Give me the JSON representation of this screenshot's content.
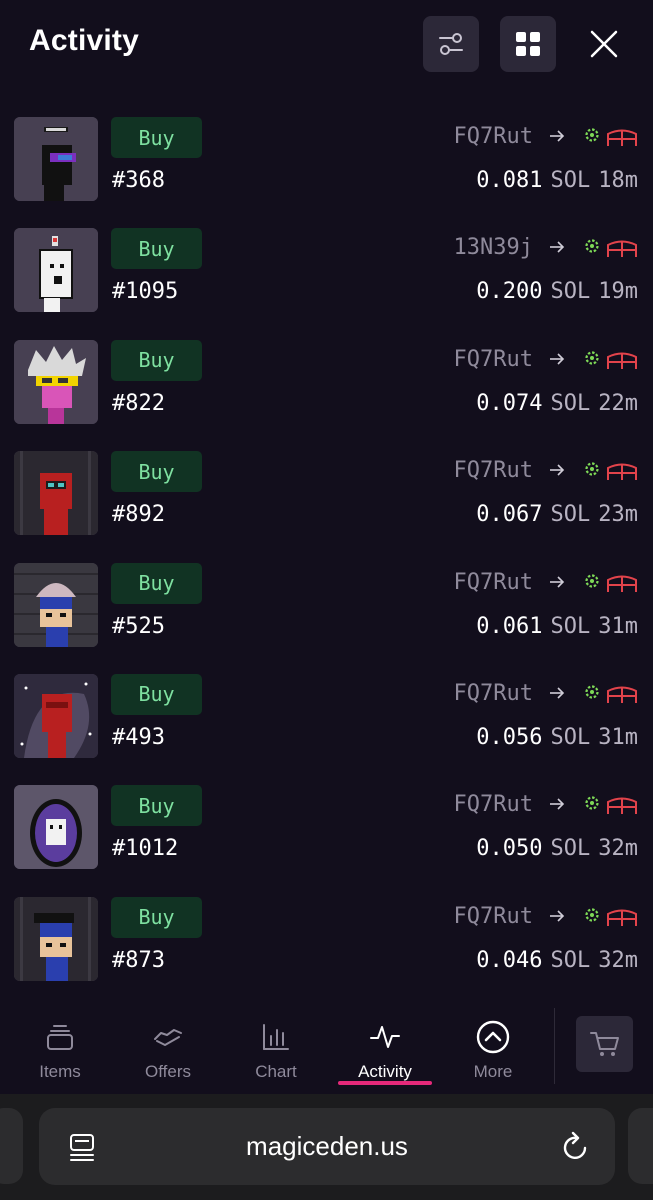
{
  "header": {
    "title": "Activity",
    "filter_icon": "sliders-icon",
    "grid_icon": "grid-view-icon",
    "close_icon": "close-icon"
  },
  "activity": [
    {
      "type": "Buy",
      "token": "#368",
      "buyer": "FQ7Rut",
      "price": "0.081",
      "unit": "SOL",
      "time": "18m"
    },
    {
      "type": "Buy",
      "token": "#1095",
      "buyer": "13N39j",
      "price": "0.200",
      "unit": "SOL",
      "time": "19m"
    },
    {
      "type": "Buy",
      "token": "#822",
      "buyer": "FQ7Rut",
      "price": "0.074",
      "unit": "SOL",
      "time": "22m"
    },
    {
      "type": "Buy",
      "token": "#892",
      "buyer": "FQ7Rut",
      "price": "0.067",
      "unit": "SOL",
      "time": "23m"
    },
    {
      "type": "Buy",
      "token": "#525",
      "buyer": "FQ7Rut",
      "price": "0.061",
      "unit": "SOL",
      "time": "31m"
    },
    {
      "type": "Buy",
      "token": "#493",
      "buyer": "FQ7Rut",
      "price": "0.056",
      "unit": "SOL",
      "time": "31m"
    },
    {
      "type": "Buy",
      "token": "#1012",
      "buyer": "FQ7Rut",
      "price": "0.050",
      "unit": "SOL",
      "time": "32m"
    },
    {
      "type": "Buy",
      "token": "#873",
      "buyer": "FQ7Rut",
      "price": "0.046",
      "unit": "SOL",
      "time": "32m"
    }
  ],
  "bottom_nav": {
    "items": [
      {
        "label": "Items",
        "icon": "stack-icon"
      },
      {
        "label": "Offers",
        "icon": "handshake-icon"
      },
      {
        "label": "Chart",
        "icon": "bar-chart-icon"
      },
      {
        "label": "Activity",
        "icon": "pulse-icon"
      },
      {
        "label": "More",
        "icon": "chevron-up-circle-icon"
      }
    ],
    "active": "Activity",
    "cart_icon": "cart-icon"
  },
  "browser": {
    "url": "magiceden.us",
    "left_icon": "reader-icon",
    "right_icon": "reload-icon"
  },
  "colors": {
    "background": "#120e1c",
    "buy_badge_bg": "#113323",
    "buy_badge_text": "#7ee0a0",
    "active_underline": "#e6297a"
  }
}
